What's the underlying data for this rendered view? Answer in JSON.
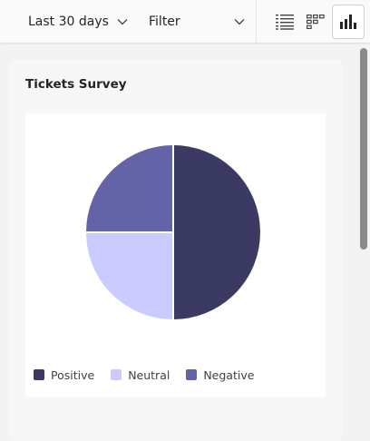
{
  "toolbar": {
    "date_range": "Last 30 days",
    "filter": "Filter",
    "views": [
      {
        "icon": "list-view-icon",
        "active": false
      },
      {
        "icon": "grid-view-icon",
        "active": false
      },
      {
        "icon": "bar-chart-icon",
        "active": true
      }
    ]
  },
  "panel": {
    "title": "Tickets Survey"
  },
  "chart_data": {
    "type": "pie",
    "title": "Tickets Survey",
    "categories": [
      "Positive",
      "Neutral",
      "Negative"
    ],
    "values": [
      50,
      25,
      25
    ],
    "colors": [
      "#3b3a63",
      "#cbcbff",
      "#6264a7"
    ],
    "legend": "bottom-left"
  },
  "colors": {
    "accent": "#3b3a63"
  }
}
